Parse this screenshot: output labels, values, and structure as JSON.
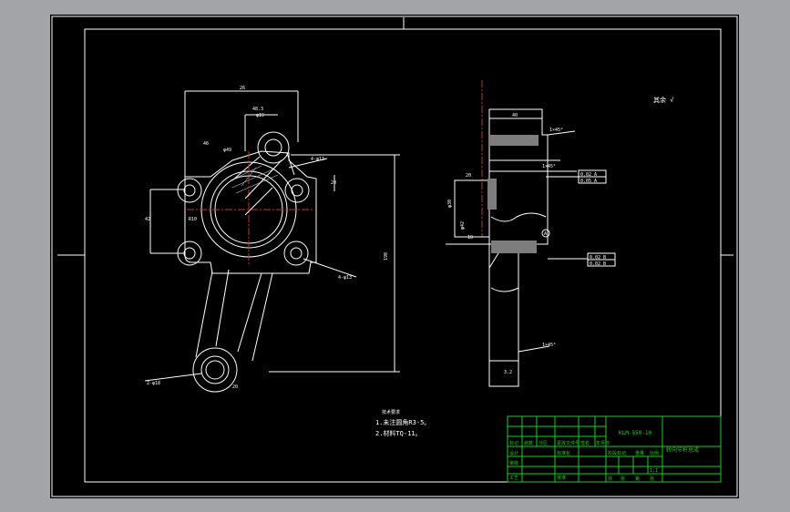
{
  "colors": {
    "workspace": "#a3a4a8",
    "canvas": "#000000",
    "line": "#ffffff",
    "titleblock": "#19d119",
    "centerline": "#c83232"
  },
  "notes": {
    "header": "技术要求",
    "line1": "1.未注圆角R3-5。",
    "line2": "2.材料TQ-11。"
  },
  "roughness_mark": "其余 √",
  "dims": {
    "top_width": "26",
    "sub_width": "48.3",
    "phi_hole": "φ15",
    "width_small": "46",
    "phi_main": "φ49",
    "height_total": "190",
    "height_block": "20",
    "height_left": "42",
    "bolt_holes": "4-φ13",
    "bolt_holes2": "4-φ13",
    "bottom_hole": "2-φ18",
    "bottom_w": "20",
    "r_label": "R10",
    "side_top": "40",
    "side_chamfer": "1×45°",
    "side_dim_b": "20",
    "side_dim_c": "φ30",
    "side_fit": "φ42",
    "side_bottom": "10",
    "side_c2": "1×45°",
    "side_c3": "1×45°",
    "bottom_ra": "3.2"
  },
  "gdt": {
    "box1": "0.02 A",
    "box2": "0.05 A",
    "box3": "0.02 B",
    "box4": "0.02 B",
    "datum": "A"
  },
  "titleblock": {
    "drawing_no": "KLM-550-10",
    "part_name": "转向节杆总成",
    "scale": "1:1",
    "row_labels": [
      "标记",
      "处数",
      "分区",
      "更改文件号",
      "签名",
      "年月日"
    ],
    "design": "设计",
    "check": "审核",
    "process": "工艺",
    "approve": "批准",
    "std": "标准化",
    "stage": "阶段标记",
    "weight": "重量",
    "ratio": "比例",
    "sheet": "共",
    "of": "张",
    "page": "第",
    "page2": "张"
  }
}
